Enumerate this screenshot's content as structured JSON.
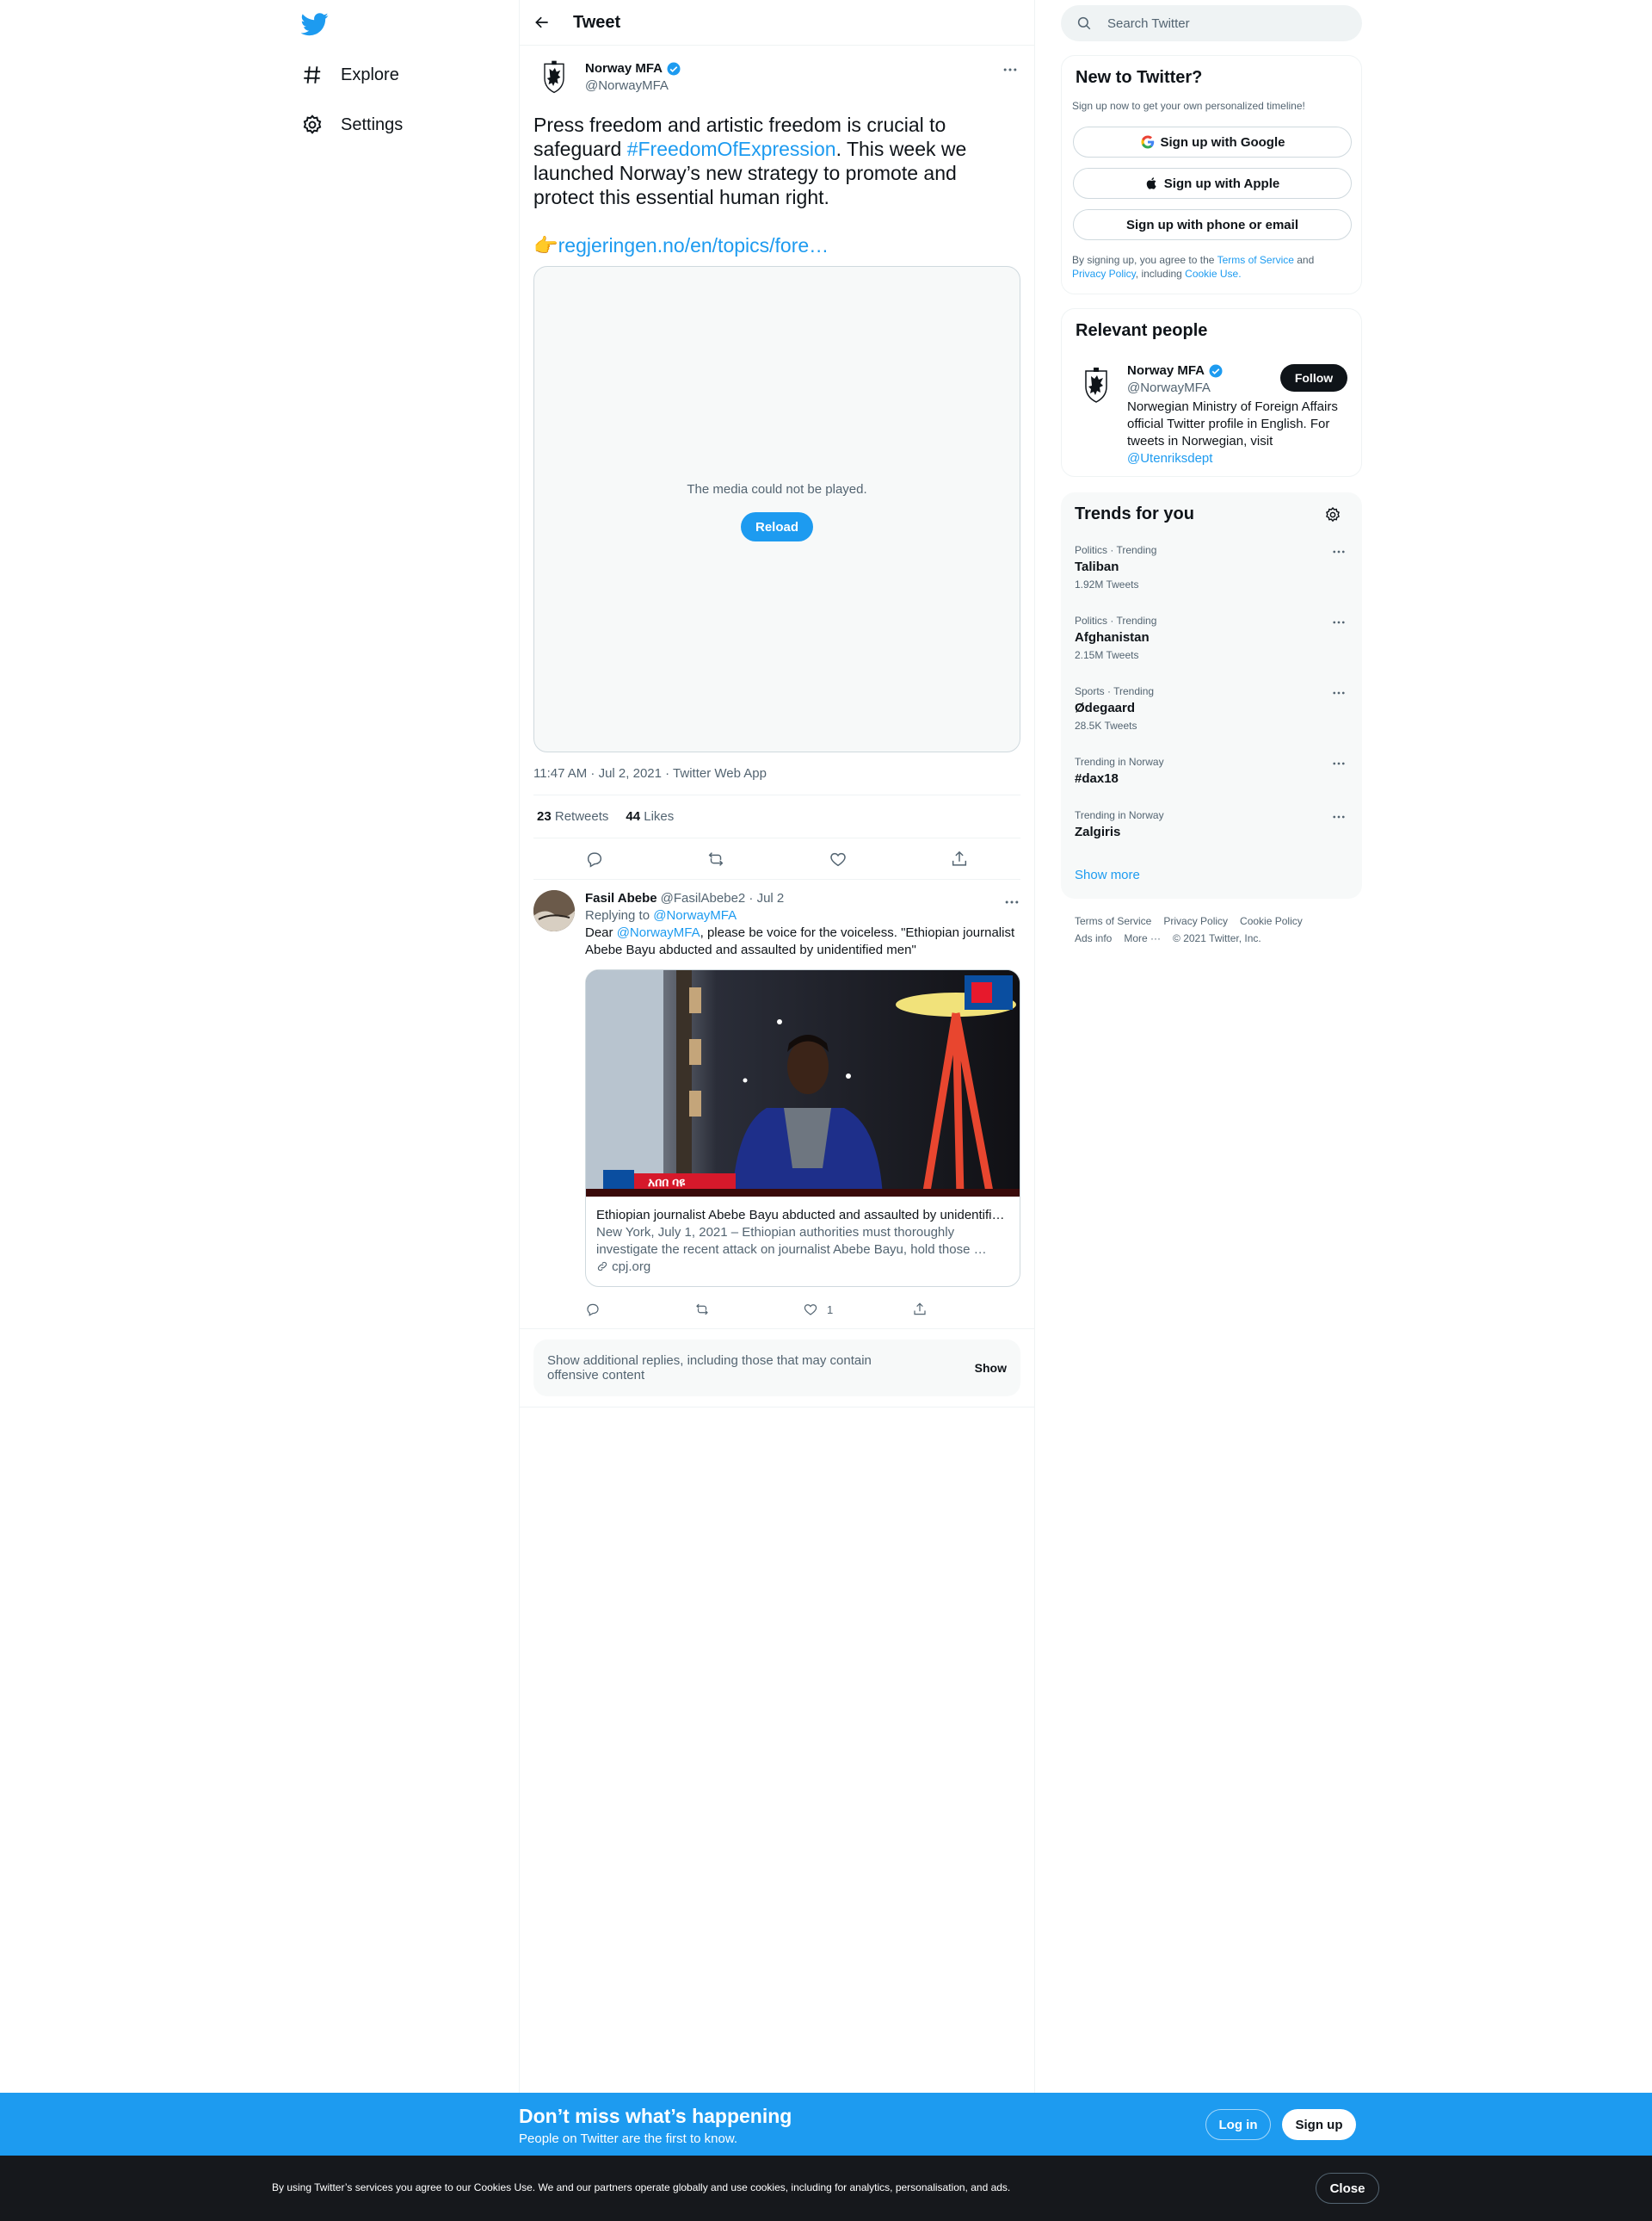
{
  "nav": {
    "logo_icon": "twitter-bird-icon",
    "items": [
      {
        "label": "Explore",
        "icon": "hashtag-icon"
      },
      {
        "label": "Settings",
        "icon": "gear-icon"
      }
    ]
  },
  "header": {
    "title": "Tweet",
    "back_icon": "back-arrow-icon"
  },
  "main_tweet": {
    "author_name": "Norway MFA",
    "author_handle": "@NorwayMFA",
    "text_part1": "Press freedom and artistic freedom is crucial to safeguard ",
    "hashtag": "#FreedomOfExpression",
    "text_part2": ". This week we launched Norway’s new strategy to promote and protect this essential human right.",
    "link_emoji": "👉",
    "link_text": "regjeringen.no/en/topics/fore…",
    "media_error": "The media could not be played.",
    "reload_label": "Reload",
    "timestamp": "11:47 AM · Jul 2, 2021 · Twitter Web App",
    "retweets_count": "23",
    "retweets_label": "Retweets",
    "likes_count": "44",
    "likes_label": "Likes"
  },
  "reply": {
    "author_name": "Fasil Abebe",
    "author_handle_date": "@FasilAbebe2 · Jul 2",
    "replying_prefix": "Replying to ",
    "replying_handle": "@NorwayMFA",
    "text_prefix": "Dear ",
    "text_mention": "@NorwayMFA",
    "text_rest": ", please be voice for the voiceless.  \"Ethiopian journalist Abebe Bayu abducted and assaulted by unidentified men\"",
    "card_title": "Ethiopian journalist Abebe Bayu abducted and assaulted by unidentifi…",
    "card_desc": "New York, July 1, 2021 – Ethiopian authorities must thoroughly investigate the recent attack on journalist Abebe Bayu, hold those …",
    "card_domain": "cpj.org",
    "card_image_caption": "አበበ ባዩ",
    "like_count": "1"
  },
  "additional_replies": {
    "text": "Show additional replies, including those that may contain offensive content",
    "button": "Show"
  },
  "search": {
    "placeholder": "Search Twitter"
  },
  "new_to_twitter": {
    "title": "New to Twitter?",
    "subtitle": "Sign up now to get your own personalized timeline!",
    "google": "Sign up with Google",
    "apple": "Sign up with Apple",
    "phone": "Sign up with phone or email",
    "terms_prefix": "By signing up, you agree to the ",
    "terms_link": "Terms of Service",
    "terms_and": " and ",
    "privacy_link": "Privacy Policy",
    "terms_including": ", including ",
    "cookie_link": "Cookie Use."
  },
  "relevant_people": {
    "title": "Relevant people",
    "name": "Norway MFA",
    "handle": "@NorwayMFA",
    "bio": "Norwegian Ministry of Foreign Affairs official Twitter profile in English. For tweets in Norwegian, visit ",
    "bio_link": "@Utenriksdept",
    "follow": "Follow"
  },
  "trends": {
    "title": "Trends for you",
    "items": [
      {
        "category": "Politics · Trending",
        "name": "Taliban",
        "count": "1.92M Tweets"
      },
      {
        "category": "Politics · Trending",
        "name": "Afghanistan",
        "count": "2.15M Tweets"
      },
      {
        "category": "Sports · Trending",
        "name": "Ødegaard",
        "count": "28.5K Tweets"
      },
      {
        "category": "Trending in Norway",
        "name": "#dax18",
        "count": ""
      },
      {
        "category": "Trending in Norway",
        "name": "Zalgiris",
        "count": ""
      }
    ],
    "show_more": "Show more"
  },
  "footer": {
    "links": [
      "Terms of Service",
      "Privacy Policy",
      "Cookie Policy",
      "Ads info",
      "More ···"
    ],
    "copyright": "© 2021 Twitter, Inc."
  },
  "signup_bar": {
    "title": "Don’t miss what’s happening",
    "subtitle": "People on Twitter are the first to know.",
    "login": "Log in",
    "signup": "Sign up"
  },
  "cookie_bar": {
    "text": "By using Twitter’s services you agree to our Cookies Use. We and our partners operate globally and use cookies, including for analytics, personalisation, and ads.",
    "close": "Close"
  },
  "colors": {
    "accent": "#1d9bf0",
    "text": "#0f1419",
    "muted": "#536471",
    "cookie_bg": "#16181c"
  }
}
